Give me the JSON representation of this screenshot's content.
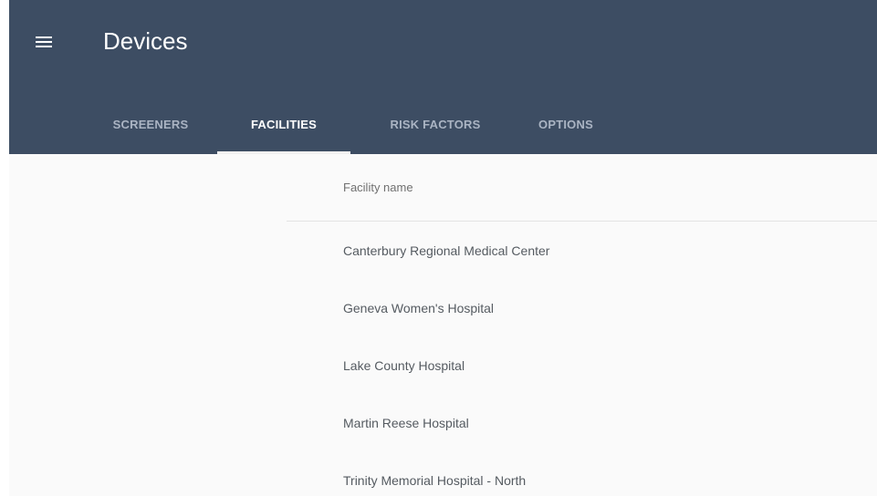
{
  "header": {
    "title": "Devices",
    "menu_icon": "hamburger-menu-icon",
    "background_color": "#3d4d63"
  },
  "tabs": [
    {
      "label": "SCREENERS",
      "active": false
    },
    {
      "label": "FACILITIES",
      "active": true
    },
    {
      "label": "RISK FACTORS",
      "active": false
    },
    {
      "label": "OPTIONS",
      "active": false
    }
  ],
  "table": {
    "column_header": "Facility name",
    "rows": [
      "Canterbury Regional Medical Center",
      "Geneva Women's Hospital",
      "Lake County Hospital",
      "Martin Reese Hospital",
      "Trinity Memorial Hospital - North"
    ]
  }
}
